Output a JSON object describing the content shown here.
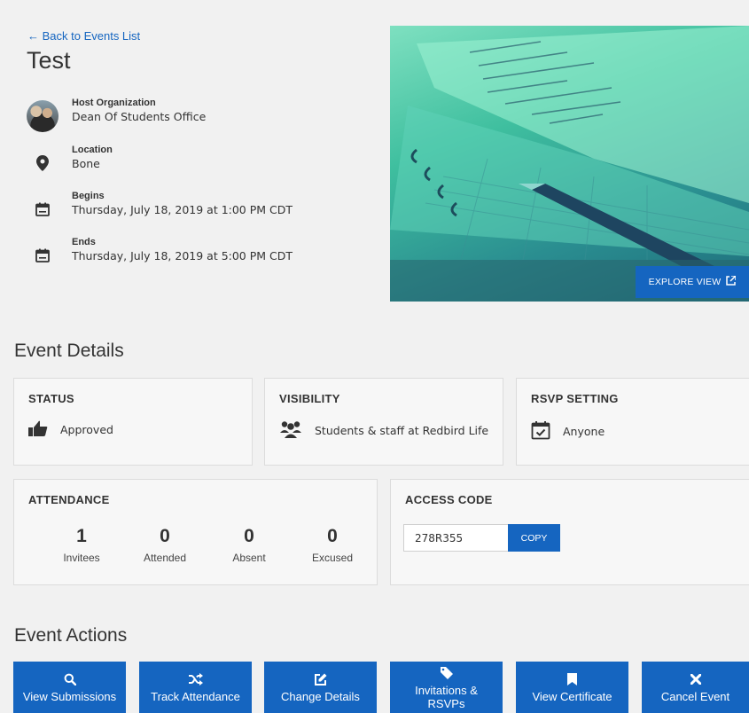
{
  "header": {
    "back_link": "← Back to Events List",
    "title": "Test"
  },
  "info": {
    "host": {
      "label": "Host Organization",
      "value": "Dean Of Students Office",
      "icon": "avatar"
    },
    "location": {
      "label": "Location",
      "value": "Bone",
      "icon": "map-pin-icon"
    },
    "begins": {
      "label": "Begins",
      "value": "Thursday, July 18, 2019 at 1:00 PM CDT",
      "icon": "calendar-icon"
    },
    "ends": {
      "label": "Ends",
      "value": "Thursday, July 18, 2019 at 5:00 PM CDT",
      "icon": "calendar-icon"
    }
  },
  "hero": {
    "explore_label": "EXPLORE VIEW"
  },
  "details": {
    "heading": "Event Details",
    "status": {
      "title": "STATUS",
      "value": "Approved",
      "icon": "thumbs-up-icon"
    },
    "visibility": {
      "title": "VISIBILITY",
      "value": "Students & staff at Redbird Life",
      "icon": "users-icon"
    },
    "rsvp": {
      "title": "RSVP SETTING",
      "value": "Anyone",
      "icon": "calendar-check-icon"
    }
  },
  "attendance": {
    "title": "ATTENDANCE",
    "stats": [
      {
        "value": "1",
        "label": "Invitees"
      },
      {
        "value": "0",
        "label": "Attended"
      },
      {
        "value": "0",
        "label": "Absent"
      },
      {
        "value": "0",
        "label": "Excused"
      }
    ]
  },
  "access": {
    "title": "ACCESS CODE",
    "code": "278R355",
    "copy_label": "COPY"
  },
  "actions": {
    "heading": "Event Actions",
    "buttons": [
      {
        "label": "View Submissions",
        "icon": "search-icon"
      },
      {
        "label": "Track Attendance",
        "icon": "shuffle-icon"
      },
      {
        "label": "Change Details",
        "icon": "edit-icon"
      },
      {
        "label": "Invitations & RSVPs",
        "icon": "tag-icon"
      },
      {
        "label": "View Certificate",
        "icon": "bookmark-icon"
      },
      {
        "label": "Cancel Event",
        "icon": "close-icon"
      }
    ]
  },
  "colors": {
    "accent": "#1565c0",
    "background": "#f1f1f1"
  }
}
